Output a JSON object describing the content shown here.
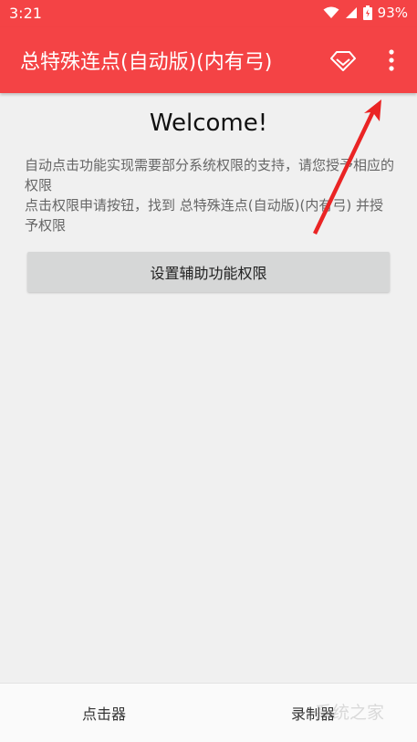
{
  "status_bar": {
    "time": "3:21",
    "battery": "93%",
    "icons": [
      "wifi-icon",
      "signal-icon",
      "battery-icon"
    ]
  },
  "app_bar": {
    "title": "总特殊连点(自动版)(内有弓)",
    "icons": [
      "diamond-icon",
      "more-vertical-icon"
    ],
    "color": "#f44345"
  },
  "main": {
    "welcome": "Welcome!",
    "description_1": "自动点击功能实现需要部分系统权限的支持，请您授予相应的权限",
    "description_2": "点击权限申请按钮，找到 总特殊连点(自动版)(内有弓) 并授予权限",
    "permission_button": "设置辅助功能权限"
  },
  "bottom_nav": {
    "items": [
      {
        "label": "点击器"
      },
      {
        "label": "录制器"
      }
    ]
  },
  "watermark": "系统之家"
}
